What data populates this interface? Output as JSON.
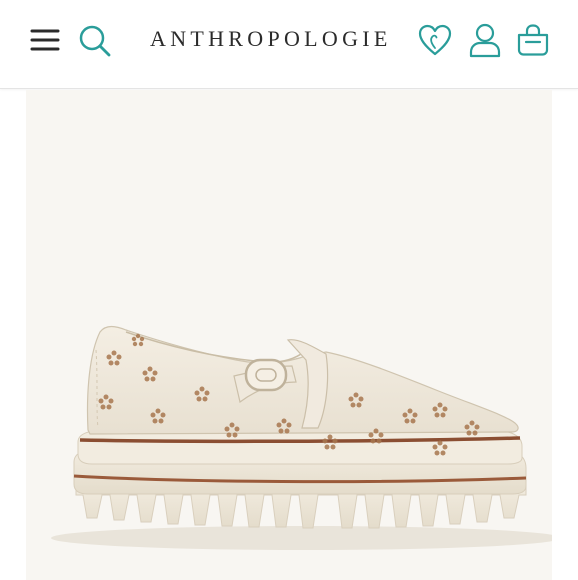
{
  "header": {
    "brand": "ANTHROPOLOGIE",
    "menu_icon": "hamburger-menu-icon",
    "search_icon": "search-icon",
    "wishlist_icon": "heart-icon",
    "account_icon": "user-icon",
    "bag_icon": "shopping-bag-icon",
    "accent_color": "#2a9d9a"
  },
  "product": {
    "image": "cream-perforated-mary-jane-platform-loafer",
    "background_color": "#f8f6f2"
  }
}
